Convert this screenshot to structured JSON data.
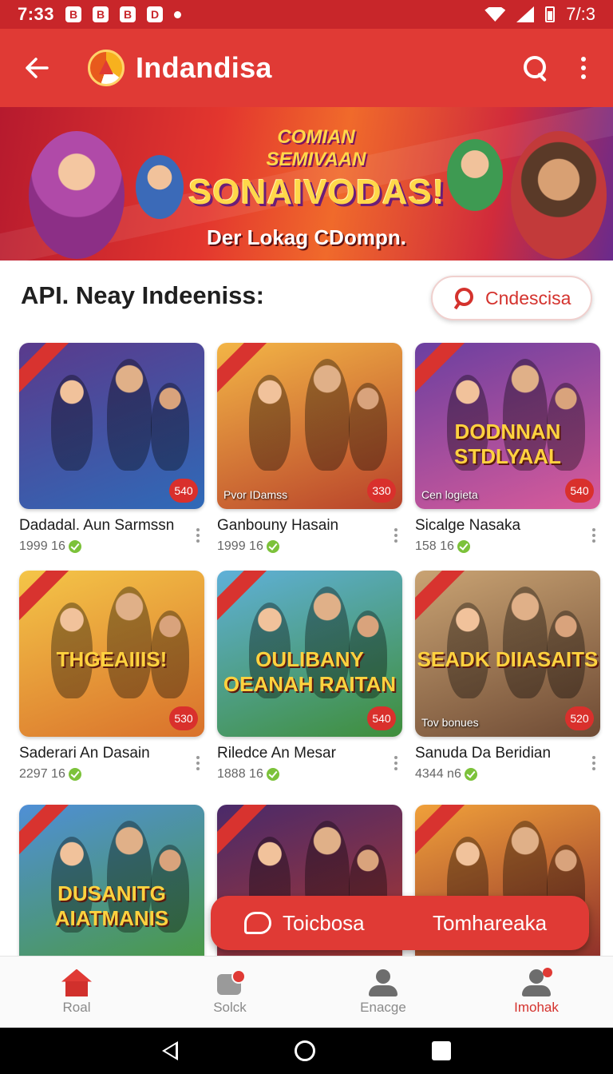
{
  "status_bar": {
    "time": "7:33",
    "notif_icons": [
      "B",
      "B",
      "B",
      "D"
    ],
    "right_text": "7/:3"
  },
  "app_bar": {
    "title": "Indandisa",
    "icons": [
      "back-arrow-icon",
      "app-logo-icon",
      "search-icon",
      "more-vert-icon"
    ]
  },
  "banner": {
    "line1": "COMIAN",
    "line2": "SEMIVAAN",
    "headline": "SONAIVODAS!",
    "subtitle": "Der Lokag CDompn."
  },
  "section": {
    "title": "API. Neay Indeeniss:",
    "filter_label": "Cndescisa"
  },
  "cards": [
    {
      "title": "Dadadal. Aun Sarmssn",
      "meta": "1999  16",
      "caption": "",
      "badge": "540",
      "art": "",
      "bg_from": "#5a3a8c",
      "bg_to": "#2f6ab8"
    },
    {
      "title": "Ganbouny Hasain",
      "meta": "1999  16",
      "caption": "Pvor IDamss",
      "badge": "330",
      "art": "",
      "bg_from": "#f3b546",
      "bg_to": "#b8422a"
    },
    {
      "title": "Sicalge Nasaka",
      "meta": "158  16",
      "caption": "Cen logieta",
      "badge": "540",
      "art": "DODNNAN STDLYAAL",
      "bg_from": "#6b3fa0",
      "bg_to": "#d95b9a"
    },
    {
      "title": "Saderari An Dasain",
      "meta": "2297  16",
      "caption": "",
      "badge": "530",
      "art": "THGEAIIIS!",
      "bg_from": "#f4c548",
      "bg_to": "#d9712b"
    },
    {
      "title": "Riledce An  Mesar",
      "meta": "1888  16",
      "caption": "",
      "badge": "540",
      "art": "OULIBANY OEANAH RAITAN",
      "bg_from": "#5fb0d8",
      "bg_to": "#3f8e3a"
    },
    {
      "title": "Sanuda Da Beridian",
      "meta": "4344  n6",
      "caption": "Tov bonues",
      "badge": "520",
      "art": "SEADK DIIASAITS",
      "bg_from": "#c9a373",
      "bg_to": "#6e4a34"
    },
    {
      "title": "",
      "meta": "",
      "caption": "",
      "badge": "",
      "art": "DUSANITG AIATMANIS",
      "bg_from": "#4f8fd6",
      "bg_to": "#4a9a3f"
    },
    {
      "title": "",
      "meta": "",
      "caption": "",
      "badge": "",
      "art": "",
      "bg_from": "#4a2a6a",
      "bg_to": "#b1382c"
    },
    {
      "title": "",
      "meta": "",
      "caption": "",
      "badge": "",
      "art": "",
      "bg_from": "#f0a03a",
      "bg_to": "#8a2a2a"
    }
  ],
  "fab": {
    "left_label": "Toicbosa",
    "right_label": "Tomhareaka"
  },
  "bottom_nav": [
    {
      "label": "Roal",
      "icon": "home-icon"
    },
    {
      "label": "Solck",
      "icon": "gift-icon"
    },
    {
      "label": "Enacge",
      "icon": "person-icon"
    },
    {
      "label": "Imohak",
      "icon": "profile-alert-icon"
    }
  ],
  "colors": {
    "primary": "#e03a35",
    "status_bar": "#c8262a",
    "accent_badge": "#d9302c",
    "verified": "#7cc23a"
  }
}
